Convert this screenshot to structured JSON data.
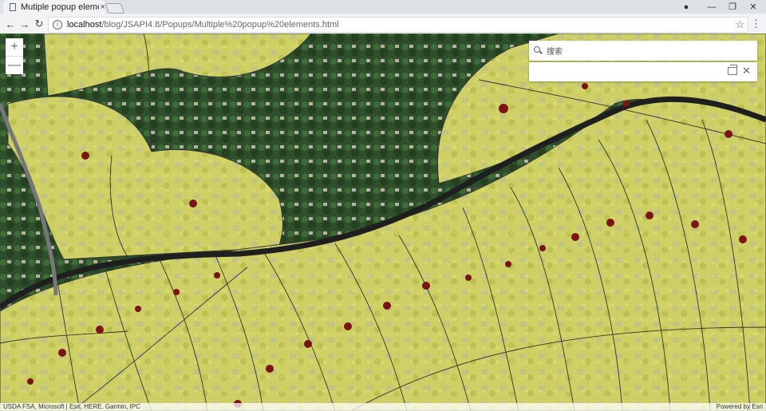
{
  "browser": {
    "tab_title": "Mutiple popup elements",
    "tab_close": "×",
    "url_host": "localhost",
    "url_path": "/blog/JSAPI4.8/Popups/Multiple%20popup%20elements.html",
    "window_controls": [
      "●",
      "—",
      "❐",
      "✕"
    ],
    "nav": {
      "back": "←",
      "forward": "→",
      "reload": "↻"
    },
    "star": "☆",
    "menu": "⋮",
    "info": "i"
  },
  "map": {
    "zoom_in": "+",
    "zoom_out": "—",
    "search_placeholder": "搜索",
    "popup": {
      "dock_title": "",
      "close": "✕"
    },
    "attribution": "USDA FSA, Microsoft | Esri, HERE, Garmin, IPC",
    "powered_by": "Powered by Esri",
    "colors": {
      "parcel_fill": "#e6e86f",
      "parcel_stroke": "#333333",
      "point_fill": "#7b1414",
      "road": "#2c2c2c"
    }
  }
}
